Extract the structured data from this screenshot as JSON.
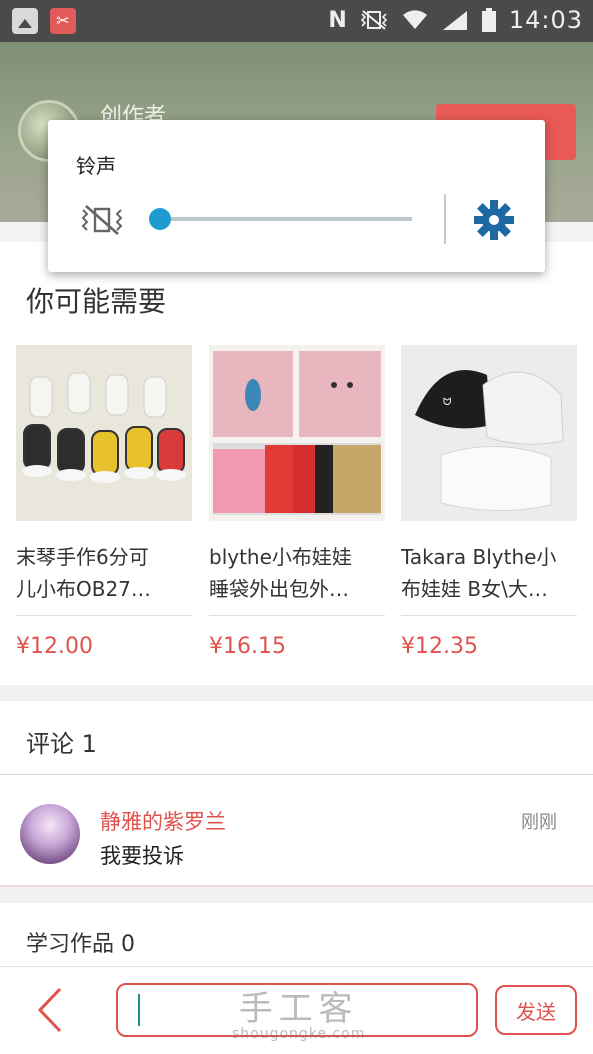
{
  "status_bar": {
    "time": "14:03",
    "icons": [
      "gallery-icon",
      "scissors-icon",
      "nfc-icon",
      "vibrate-icon",
      "wifi-icon",
      "signal-icon",
      "battery-icon"
    ]
  },
  "header": {
    "creator_label": "创作者"
  },
  "volume_popup": {
    "title": "铃声",
    "mute_icon": "vibrate-mute-icon",
    "settings_icon": "gear-icon",
    "level": 0,
    "accent": "#1e9bd1"
  },
  "recommend": {
    "title": "你可能需要",
    "items": [
      {
        "name": "末琴手作6分可儿小布OB27…",
        "name_line1": "末琴手作6分可",
        "name_line2": "儿小布OB27…",
        "price": "¥12.00"
      },
      {
        "name": "blythe小布娃娃睡袋外出包外…",
        "name_line1": "blythe小布娃娃",
        "name_line2": "睡袋外出包外…",
        "price": "¥16.15"
      },
      {
        "name": "Takara Blythe小布娃娃 B女\\大…",
        "name_line1": "Takara Blythe小",
        "name_line2": "布娃娃 B女\\大…",
        "price": "¥12.35"
      }
    ]
  },
  "comments": {
    "title": "评论 1",
    "list": [
      {
        "user": "静雅的紫罗兰",
        "time": "刚刚",
        "text": "我要投诉"
      }
    ]
  },
  "works": {
    "title": "学习作品 0"
  },
  "bottom_bar": {
    "input_value": "",
    "send_label": "发送",
    "watermark_cn": "手工客",
    "watermark_en": "shougongke.com"
  },
  "colors": {
    "brand_red": "#e0524e",
    "status_bar": "#4a4a4a"
  }
}
